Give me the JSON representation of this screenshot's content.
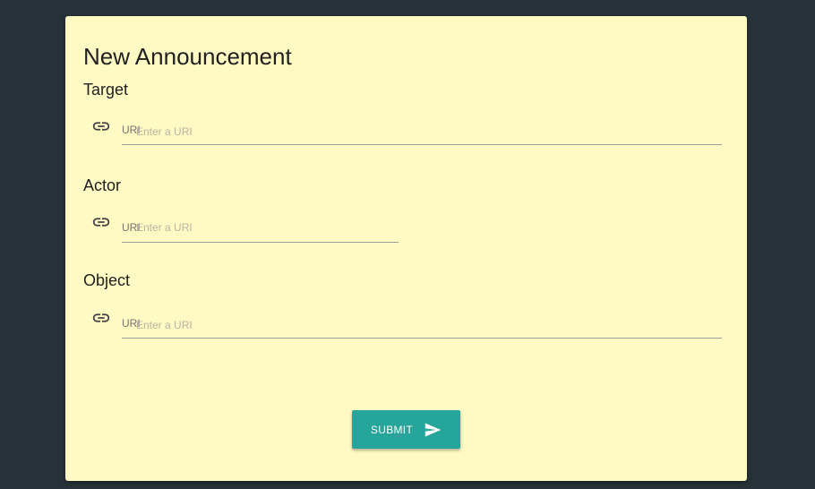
{
  "form": {
    "title": "New Announcement",
    "fields": [
      {
        "label": "Target",
        "float_label": "URI",
        "placeholder": "Enter a URI",
        "value": "",
        "icon": "link-icon"
      },
      {
        "label": "Actor",
        "float_label": "URI",
        "placeholder": "Enter a URI",
        "value": "",
        "icon": "link-icon"
      },
      {
        "label": "Object",
        "float_label": "URI",
        "placeholder": "Enter a URI",
        "value": "",
        "icon": "link-icon"
      }
    ],
    "submit": {
      "label": "SUBMIT",
      "icon": "send-icon"
    }
  },
  "colors": {
    "background": "#263238",
    "card": "#fff9c4",
    "accent": "#26a69a"
  }
}
